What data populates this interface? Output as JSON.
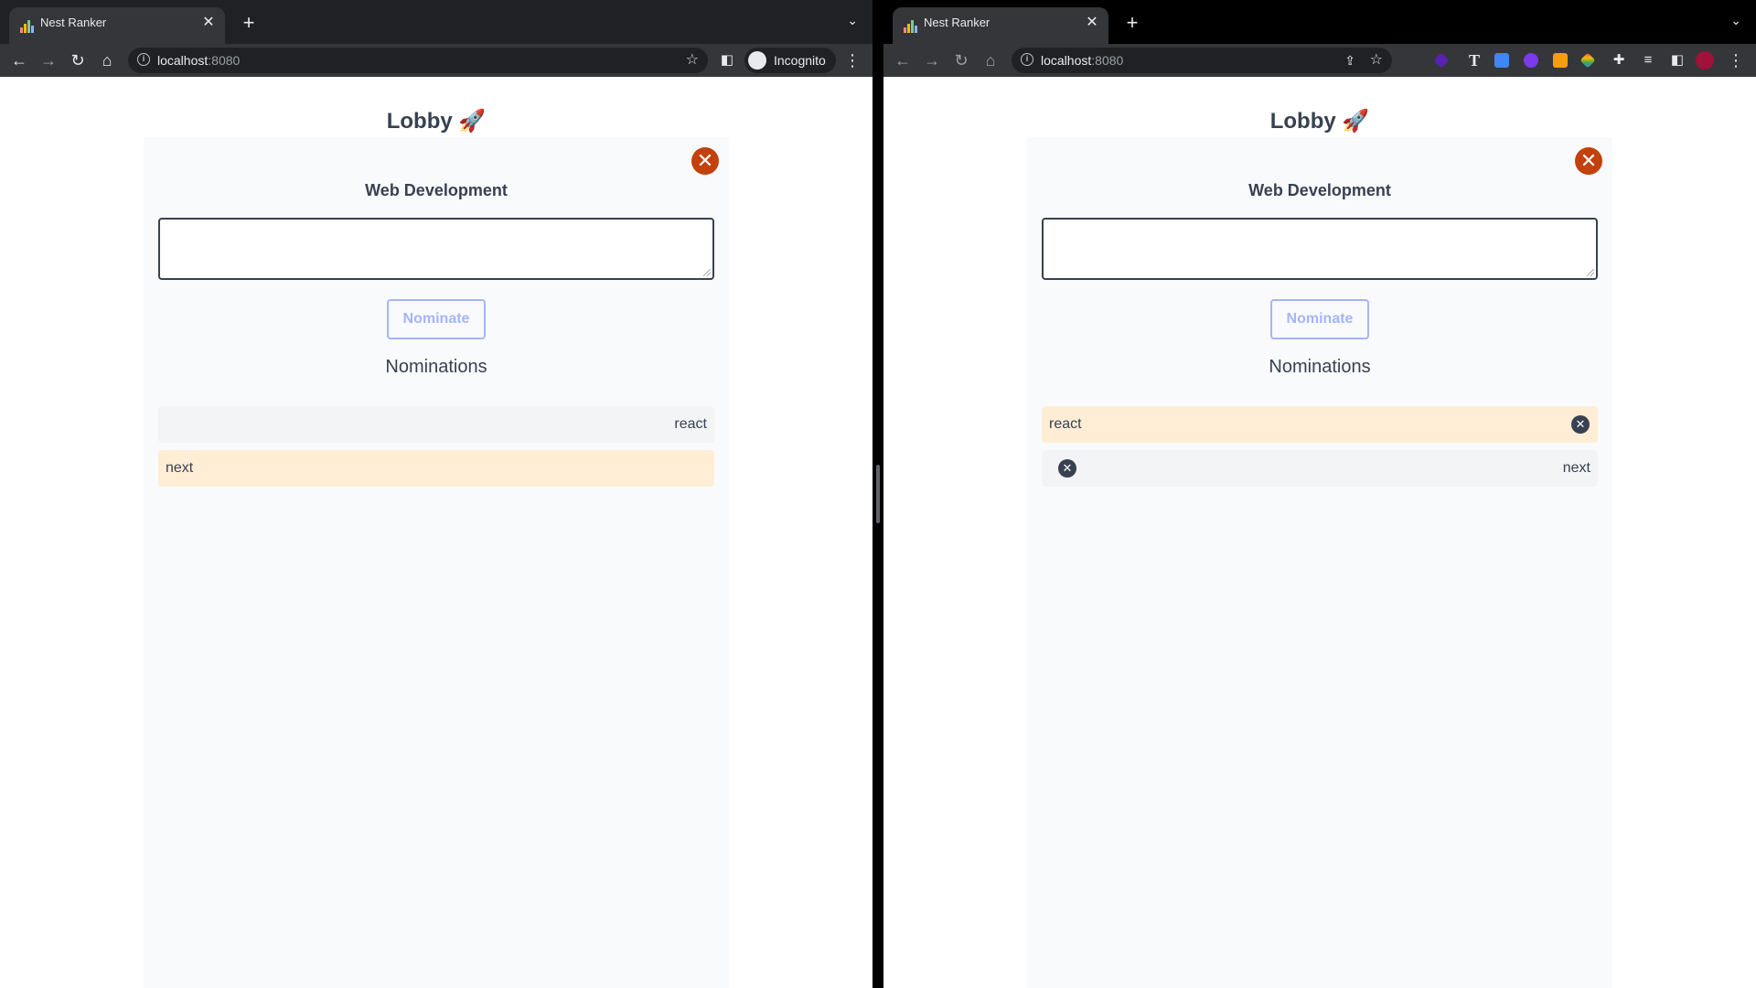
{
  "left_window": {
    "tab": {
      "title": "Nest Ranker",
      "close": "✕"
    },
    "new_tab": "+",
    "tab_dropdown": "⌄",
    "address": {
      "host": "localhost",
      "port": ":8080"
    },
    "profile_label": "Incognito",
    "app": {
      "title": "Lobby 🚀",
      "topic": "Web Development",
      "input_value": "",
      "nominate_label": "Nominate",
      "nominations_heading": "Nominations",
      "nominations": [
        {
          "text": "react",
          "align": "right",
          "highlight": false
        },
        {
          "text": "next",
          "align": "left",
          "highlight": true
        }
      ]
    }
  },
  "right_window": {
    "tab": {
      "title": "Nest Ranker",
      "close": "✕"
    },
    "new_tab": "+",
    "tab_dropdown": "⌄",
    "address": {
      "host": "localhost",
      "port": ":8080"
    },
    "app": {
      "title": "Lobby 🚀",
      "topic": "Web Development",
      "input_value": "",
      "nominate_label": "Nominate",
      "nominations_heading": "Nominations",
      "nominations": [
        {
          "text": "react",
          "align": "left",
          "highlight": true,
          "removable": true
        },
        {
          "text": "next",
          "align": "right",
          "highlight": false,
          "removable": true
        }
      ]
    }
  },
  "colors": {
    "leave_button": "#c2410c",
    "nominate_border": "#a5b4fc",
    "highlight_row": "#ffedd5",
    "neutral_row": "#f3f4f6",
    "panel": "#f9fafb",
    "text": "#374151"
  },
  "icons": {
    "leave": "close-circle-icon",
    "remove": "x-circle-icon",
    "back": "arrow-left-icon",
    "forward": "arrow-right-icon",
    "reload": "reload-icon",
    "home": "home-icon",
    "bookmark": "star-icon",
    "side_panel": "side-panel-icon",
    "menu": "kebab-menu-icon",
    "share": "share-icon",
    "extensions": "puzzle-icon"
  }
}
